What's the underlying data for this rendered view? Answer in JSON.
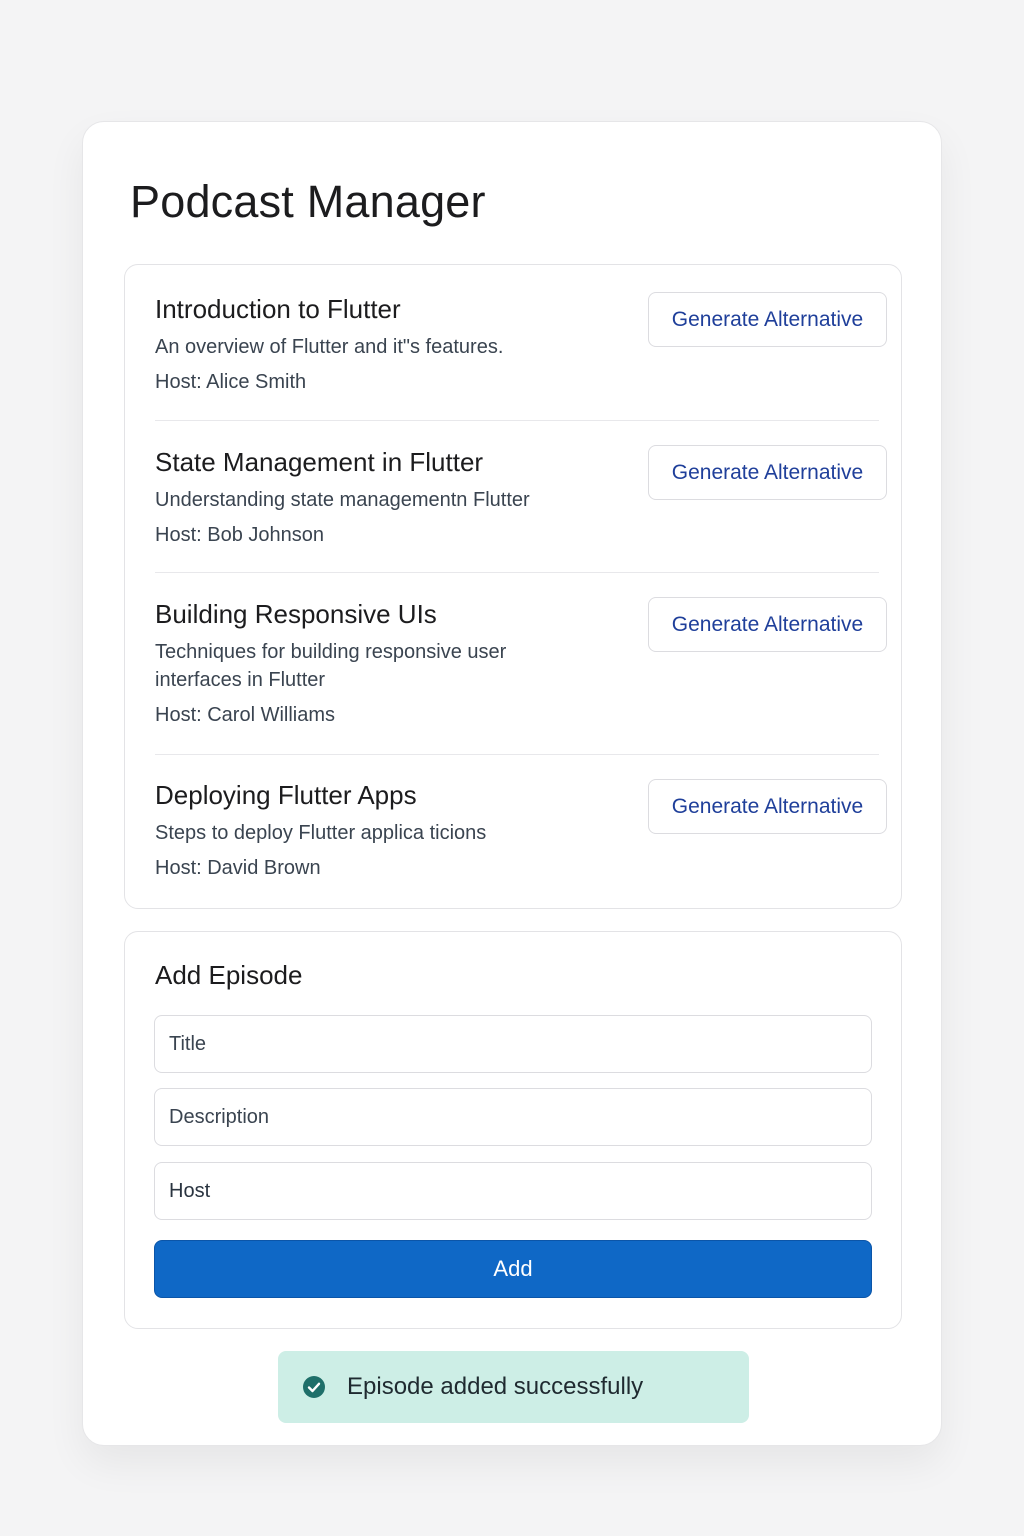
{
  "app": {
    "title": "Podcast Manager"
  },
  "episodes": [
    {
      "title": "Introduction to Flutter",
      "description": "An overview of Flutter and it\"s features.",
      "host": "Host: Alice Smith",
      "action_label": "Generate Alternative"
    },
    {
      "title": "State Management in Flutter",
      "description": "Understanding state managementn Flutter",
      "host": "Host: Bob Johnson",
      "action_label": "Generate Alternative"
    },
    {
      "title": "Building Responsive UIs",
      "description": "Techniques for building responsive user interfaces in Flutter",
      "host": "Host: Carol Williams",
      "action_label": "Generate Alternative"
    },
    {
      "title": "Deploying Flutter Apps",
      "description": "Steps to deploy Flutter applica ticions",
      "host": "Host: David Brown",
      "action_label": "Generate Alternative"
    }
  ],
  "add_episode": {
    "heading": "Add Episode",
    "title_placeholder": "Title",
    "description_placeholder": "Description",
    "host_value": "Host",
    "submit_label": "Add"
  },
  "toast": {
    "message": "Episode added successfully",
    "icon": "check-circle-icon"
  },
  "colors": {
    "primary": "#0f68c6",
    "link": "#1f3f9a",
    "toast_bg": "#cdeee6",
    "toast_icon": "#1f6f6a"
  }
}
